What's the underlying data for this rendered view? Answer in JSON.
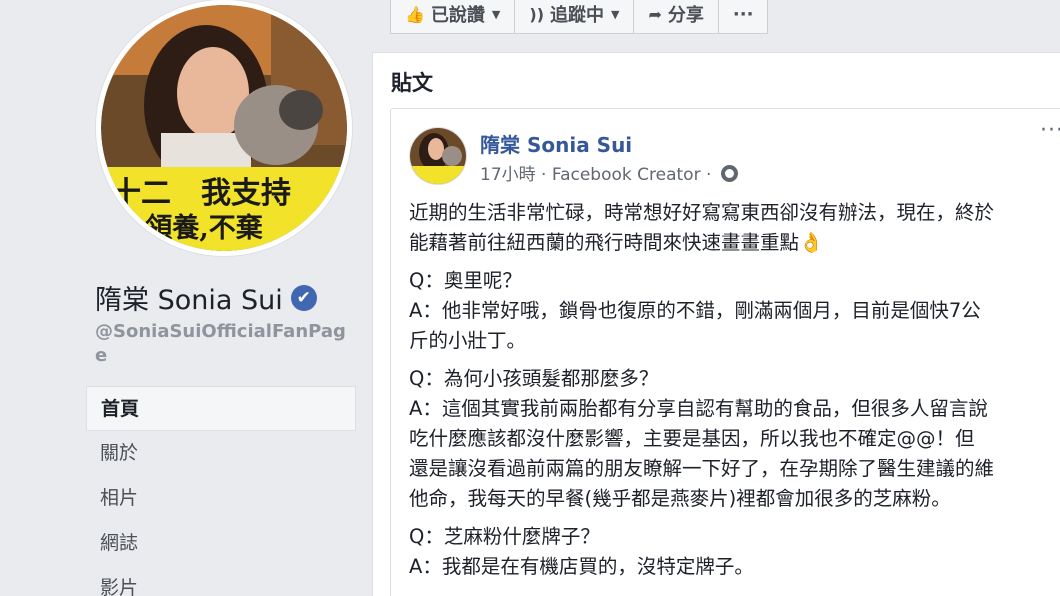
{
  "sidebar": {
    "page_name": "隋棠 Sonia Sui",
    "verified_icon": "✔",
    "handle": "@SoniaSuiOfficialFanPage",
    "avatar_text_line1": "十二　我支持",
    "avatar_text_line2": "夜 領養,不棄",
    "nav": [
      {
        "label": "首頁",
        "active": true
      },
      {
        "label": "關於"
      },
      {
        "label": "相片"
      },
      {
        "label": "網誌"
      },
      {
        "label": "影片"
      }
    ]
  },
  "action_bar": {
    "liked": {
      "icon": "thumbs-up-icon",
      "label": "已說讚"
    },
    "following": {
      "icon": "rss-icon",
      "label": "追蹤中"
    },
    "share": {
      "icon": "share-arrow-icon",
      "label": "分享"
    },
    "more": "···"
  },
  "posts": {
    "title": "貼文",
    "post": {
      "author": "隋棠 Sonia Sui",
      "time": "17小時",
      "separator": "·",
      "app": "Facebook Creator",
      "separator2": "·",
      "more": "···",
      "lines": [
        "近期的生活非常忙碌，時常想好好寫寫東西卻沒有辦法，現在，終於",
        "能藉著前往紐西蘭的飛行時間來快速畫畫重點👌",
        "Q：奧里呢？",
        "A：他非常好哦，鎖骨也復原的不錯，剛滿兩個月，目前是個快7公",
        "斤的小壯丁。",
        "Q：為何小孩頭髮都那麼多？",
        "A：這個其實我前兩胎都有分享自認有幫助的食品，但很多人留言說",
        "吃什麼應該都沒什麼影響，主要是基因，所以我也不確定@@！但",
        "還是讓沒看過前兩篇的朋友瞭解一下好了，在孕期除了醫生建議的維",
        "他命，我每天的早餐(幾乎都是燕麥片)裡都會加很多的芝麻粉。",
        "Q：芝麻粉什麼牌子？",
        "A：我都是在有機店買的，沒特定牌子。"
      ]
    }
  }
}
